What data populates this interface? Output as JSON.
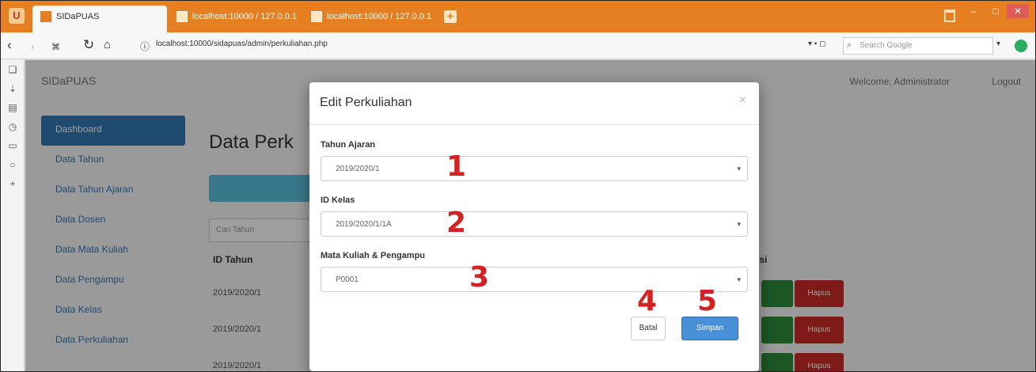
{
  "browser": {
    "active_tab": "SIDaPUAS",
    "tab2": "localhost:10000 / 127.0.0.1",
    "tab3": "localhost:10000 / 127.0.0.1",
    "url": "localhost:10000/sidapuas/admin/perkuliahan.php",
    "search_placeholder": "Search Google"
  },
  "app": {
    "brand": "SIDaPUAS",
    "welcome": "Welcome, Administrator",
    "logout": "Logout",
    "menu": [
      "Dashboard",
      "Data Tahun",
      "Data Tahun Ajaran",
      "Data Dosen",
      "Data Mata Kuliah",
      "Data Pengampu",
      "Data Kelas",
      "Data Perkuliahan"
    ],
    "page_title": "Data Perk",
    "search_placeholder": "Cari Tahun",
    "col_id_tahun": "ID Tahun",
    "col_aksi": "psi",
    "rows": [
      "2019/2020/1",
      "2019/2020/1",
      "2019/2020/1"
    ],
    "delete_label": "Hapus"
  },
  "modal": {
    "title": "Edit Perkuliahan",
    "close": "×",
    "field1_label": "Tahun Ajaran",
    "field1_value": "2019/2020/1",
    "field2_label": "ID Kelas",
    "field2_value": "2019/2020/1/1A",
    "field3_label": "Mata Kuliah & Pengampu",
    "field3_value": "P0001",
    "cancel_label": "Batal",
    "save_label": "Simpan"
  },
  "markers": [
    "1",
    "2",
    "3",
    "4",
    "5"
  ],
  "colors": {
    "titlebar": "#e67e22",
    "primary": "#337ab7",
    "danger": "#cc2b26",
    "success": "#2e8b3a",
    "marker": "#d32222"
  }
}
